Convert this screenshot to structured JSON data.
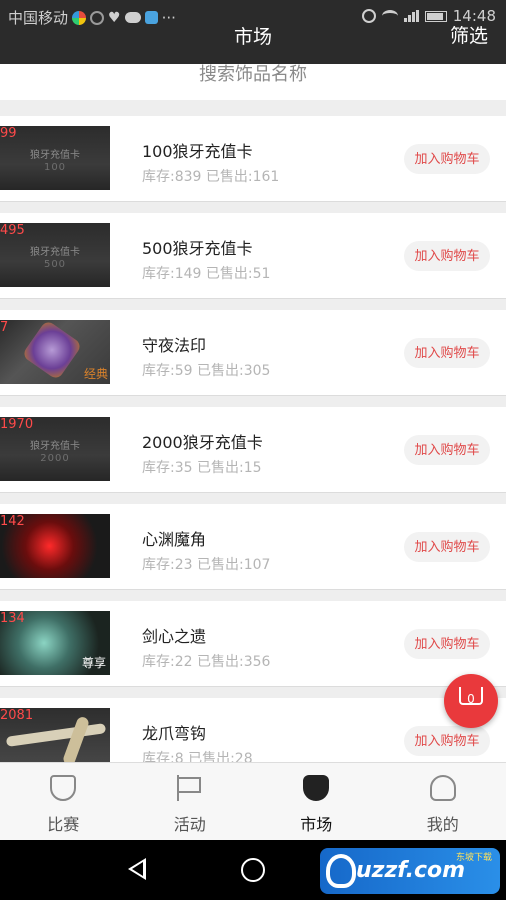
{
  "status_bar": {
    "carrier": "中国移动",
    "dots": "···",
    "time": "14:48"
  },
  "header": {
    "title": "市场",
    "filter_label": "筛选",
    "background": "#2b2b2b"
  },
  "search": {
    "placeholder": "搜索饰品名称"
  },
  "items": [
    {
      "price": "99",
      "thumb_text": "狼牙充值卡",
      "thumb_num": "100",
      "name": "100狼牙充值卡",
      "stock": "库存:839 已售出:161",
      "action": "加入购物车"
    },
    {
      "price": "495",
      "thumb_text": "狼牙充值卡",
      "thumb_num": "500",
      "name": "500狼牙充值卡",
      "stock": "库存:149 已售出:51",
      "action": "加入购物车"
    },
    {
      "price": "7",
      "thumb_tag": "经典",
      "name": "守夜法印",
      "stock": "库存:59 已售出:305",
      "action": "加入购物车"
    },
    {
      "price": "1970",
      "thumb_text": "狼牙充值卡",
      "thumb_num": "2000",
      "name": "2000狼牙充值卡",
      "stock": "库存:35 已售出:15",
      "action": "加入购物车"
    },
    {
      "price": "142",
      "name": "心渊魔角",
      "stock": "库存:23 已售出:107",
      "action": "加入购物车"
    },
    {
      "price": "134",
      "thumb_tag": "尊享",
      "name": "剑心之遗",
      "stock": "库存:22 已售出:356",
      "action": "加入购物车"
    },
    {
      "price": "2081",
      "name": "龙爪弯钩",
      "stock": "库存:8 已售出:28",
      "action": "加入购物车"
    }
  ],
  "cart": {
    "count": "0",
    "color": "#e9393c"
  },
  "tabs": [
    {
      "label": "比赛",
      "icon": "shield-icon"
    },
    {
      "label": "活动",
      "icon": "flag-icon"
    },
    {
      "label": "市场",
      "icon": "market-icon",
      "active": true
    },
    {
      "label": "我的",
      "icon": "user-icon"
    }
  ],
  "watermark": {
    "text": "uzzf.com",
    "sub": "东坡下载"
  }
}
